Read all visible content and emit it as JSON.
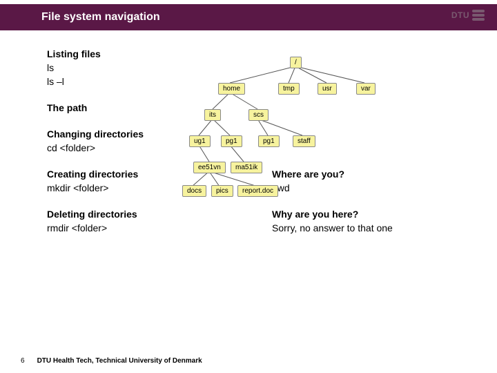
{
  "title": "File system navigation",
  "logo_text": "DTU",
  "sections": {
    "listing_h": "Listing files",
    "listing_1": "ls",
    "listing_2": "ls –l",
    "path_h": "The path",
    "chdir_h": "Changing directories",
    "chdir_1": "cd <folder>",
    "mkdir_h": "Creating directories",
    "mkdir_1": "mkdir <folder>",
    "rmdir_h": "Deleting directories",
    "rmdir_1": "rmdir <folder>",
    "where_h": "Where are you?",
    "where_1": "pwd",
    "why_h": "Why are you here?",
    "why_1": "Sorry, no answer to that one"
  },
  "tree": {
    "root": "/",
    "l1": [
      "home",
      "tmp",
      "usr",
      "var"
    ],
    "l2": [
      "its",
      "scs"
    ],
    "l3a": [
      "ug1",
      "pg1"
    ],
    "l3b": [
      "pg1",
      "staff"
    ],
    "l4a": [
      "ee51vn",
      "ma51ik"
    ],
    "l5": [
      "docs",
      "pics",
      "report.doc"
    ]
  },
  "footer": {
    "page": "6",
    "org": "DTU Health Tech, Technical University of Denmark"
  }
}
